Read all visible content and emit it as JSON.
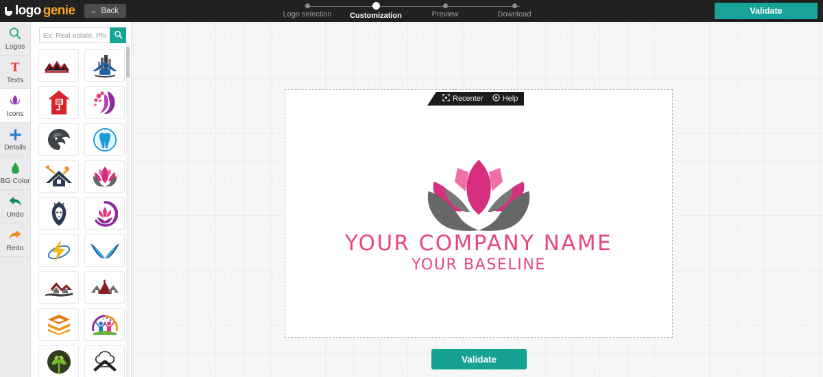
{
  "brand": {
    "part1": "logo",
    "part2": "genie",
    "icon": "genie-lamp-icon"
  },
  "topbar": {
    "back_label": "Back",
    "validate_label": "Validate",
    "steps": [
      {
        "label": "Logo selection",
        "active": false
      },
      {
        "label": "Customization",
        "active": true
      },
      {
        "label": "Preview",
        "active": false
      },
      {
        "label": "Download",
        "active": false
      }
    ]
  },
  "rail": {
    "items": [
      {
        "label": "Logos",
        "icon": "magnifier-icon",
        "color": "#1faa7a",
        "selected": false
      },
      {
        "label": "Texts",
        "icon": "letter-t-icon",
        "color": "#e03b2f",
        "selected": false
      },
      {
        "label": "Icons",
        "icon": "tulip-icon",
        "color": "#8e35b5",
        "selected": true
      },
      {
        "label": "Details",
        "icon": "plus-icon",
        "color": "#2f7fd1",
        "selected": false
      },
      {
        "label": "BG Color",
        "icon": "droplet-icon",
        "color": "#27a544",
        "selected": false
      },
      {
        "label": "Undo",
        "icon": "undo-arrow-icon",
        "color": "#12855f",
        "selected": false
      },
      {
        "label": "Redo",
        "icon": "redo-arrow-icon",
        "color": "#f08a1e",
        "selected": false
      }
    ]
  },
  "panel": {
    "search_placeholder": "Ex: Real estate, Photo...",
    "search_icon": "search-icon",
    "thumbnails": [
      {
        "name": "red-black-rooftops-logo"
      },
      {
        "name": "blue-city-buildings-house-logo"
      },
      {
        "name": "red-house-paint-roller-logo"
      },
      {
        "name": "purple-woman-hair-floral-logo"
      },
      {
        "name": "dark-gray-lion-swirl-logo"
      },
      {
        "name": "blue-dental-tooth-circle-logo"
      },
      {
        "name": "house-hammer-wrench-repair-logo"
      },
      {
        "name": "pink-lotus-hands-logo"
      },
      {
        "name": "navy-lion-head-crest-logo"
      },
      {
        "name": "purple-lotus-circle-hand-logo"
      },
      {
        "name": "yellow-lightning-bolt-swirl-logo"
      },
      {
        "name": "blue-wings-bird-logo"
      },
      {
        "name": "dark-red-roofs-landscape-logo"
      },
      {
        "name": "red-gray-rooftops-logo"
      },
      {
        "name": "orange-stacked-layers-logo"
      },
      {
        "name": "colorful-children-celebration-logo"
      },
      {
        "name": "green-tree-circle-logo"
      },
      {
        "name": "chef-hat-crossed-knives-logo"
      }
    ]
  },
  "canvas": {
    "toolbar": {
      "recenter_label": "Recenter",
      "recenter_icon": "recenter-frame-icon",
      "help_label": "Help",
      "help_icon": "play-circle-icon"
    },
    "logo": {
      "artwork": "pink-lotus-in-hands-logo",
      "company_name": "YOUR COMPANY NAME",
      "baseline": "YOUR BASELINE",
      "text_color": "#e8467f",
      "petal_color": "#d62f7e",
      "petal_light_color": "#ef6fa6",
      "hands_color": "#676767"
    },
    "validate_label": "Validate"
  },
  "colors": {
    "accent_teal": "#17a398",
    "brand_orange": "#f5a020",
    "topbar_bg": "#212121",
    "pink": "#e8467f"
  }
}
